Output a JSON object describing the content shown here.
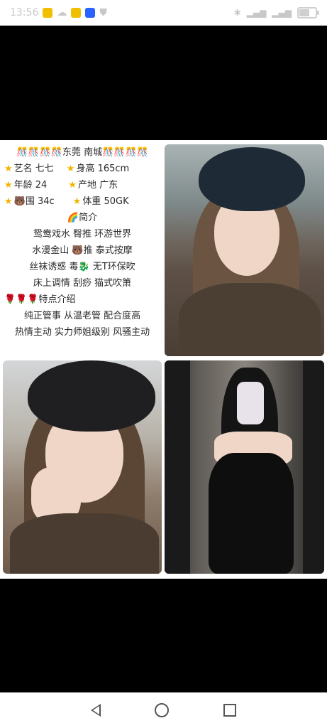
{
  "status_bar": {
    "time": "13:56",
    "battery_percent": 60
  },
  "profile": {
    "header": "🎊🎊🎊🎊东莞  南城🎊🎊🎊🎊",
    "row1": {
      "a": "艺名 七七",
      "b": "身高 165cm"
    },
    "row2": {
      "a": "年龄  24",
      "b": "产地  广东"
    },
    "row3": {
      "a": "🐻围  34c",
      "b": "体重 50GK"
    },
    "intro_title": "🌈简介",
    "intro_lines": [
      "鸳鸯戏水  臀推  环游世界",
      "水漫金山  🐻推  泰式按摩",
      "丝袜诱惑  毒🐉  无T环保吹",
      "床上调情   刮痧    猫式吹箫"
    ],
    "features_title": "🌹🌹🌹特点介绍",
    "feature_lines": [
      "纯正管事 从温老管   配合度高",
      "热情主动  实力师姐级别  风骚主动"
    ]
  },
  "icons": {
    "nav_back": "back-triangle-icon",
    "nav_home": "home-circle-icon",
    "nav_recent": "recent-square-icon"
  }
}
